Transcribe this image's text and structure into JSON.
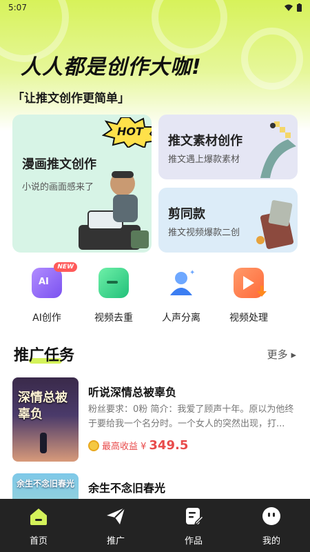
{
  "status_bar": {
    "time": "5:07"
  },
  "hero": {
    "title": "人人都是创作大咖!",
    "subtitle": "「让推文创作更简单」"
  },
  "cards": {
    "big": {
      "title": "漫画推文创作",
      "desc": "小说的画面感来了",
      "badge": "HOT"
    },
    "top_right": {
      "title": "推文素材创作",
      "desc": "推文遇上爆款素材"
    },
    "bottom_right": {
      "title": "剪同款",
      "desc": "推文视频爆款二创"
    }
  },
  "tools": [
    {
      "label": "AI创作",
      "badge": "NEW",
      "icon": "ai-create-icon",
      "color": "#9b6bf5"
    },
    {
      "label": "视频去重",
      "icon": "video-dedupe-icon",
      "color": "#3ed28b"
    },
    {
      "label": "人声分离",
      "icon": "voice-separate-icon",
      "color": "#4a8ff7"
    },
    {
      "label": "视频处理",
      "icon": "video-process-icon",
      "color": "#ff7a45"
    }
  ],
  "section": {
    "title": "推广任务",
    "more": "更多"
  },
  "tasks": [
    {
      "title": "听说深情总被辜负",
      "desc": "粉丝要求：0粉  简介：我爱了顾声十年。原以为他终于要给我一个名分时。一个女人的突然出现，打...",
      "earn_label": "最高收益 ¥",
      "earn_value": "349.5",
      "cover_text": "深情总被辜负"
    },
    {
      "title": "余生不念旧春光",
      "cover_text": "余生不念旧春光"
    }
  ],
  "tabbar": [
    {
      "label": "首页",
      "icon": "home-icon",
      "active": true
    },
    {
      "label": "推广",
      "icon": "send-icon"
    },
    {
      "label": "作品",
      "icon": "works-icon"
    },
    {
      "label": "我的",
      "icon": "profile-icon"
    }
  ],
  "colors": {
    "accent": "#d4f25a",
    "earn": "#e84b4b",
    "tabbar_bg": "#232323"
  }
}
